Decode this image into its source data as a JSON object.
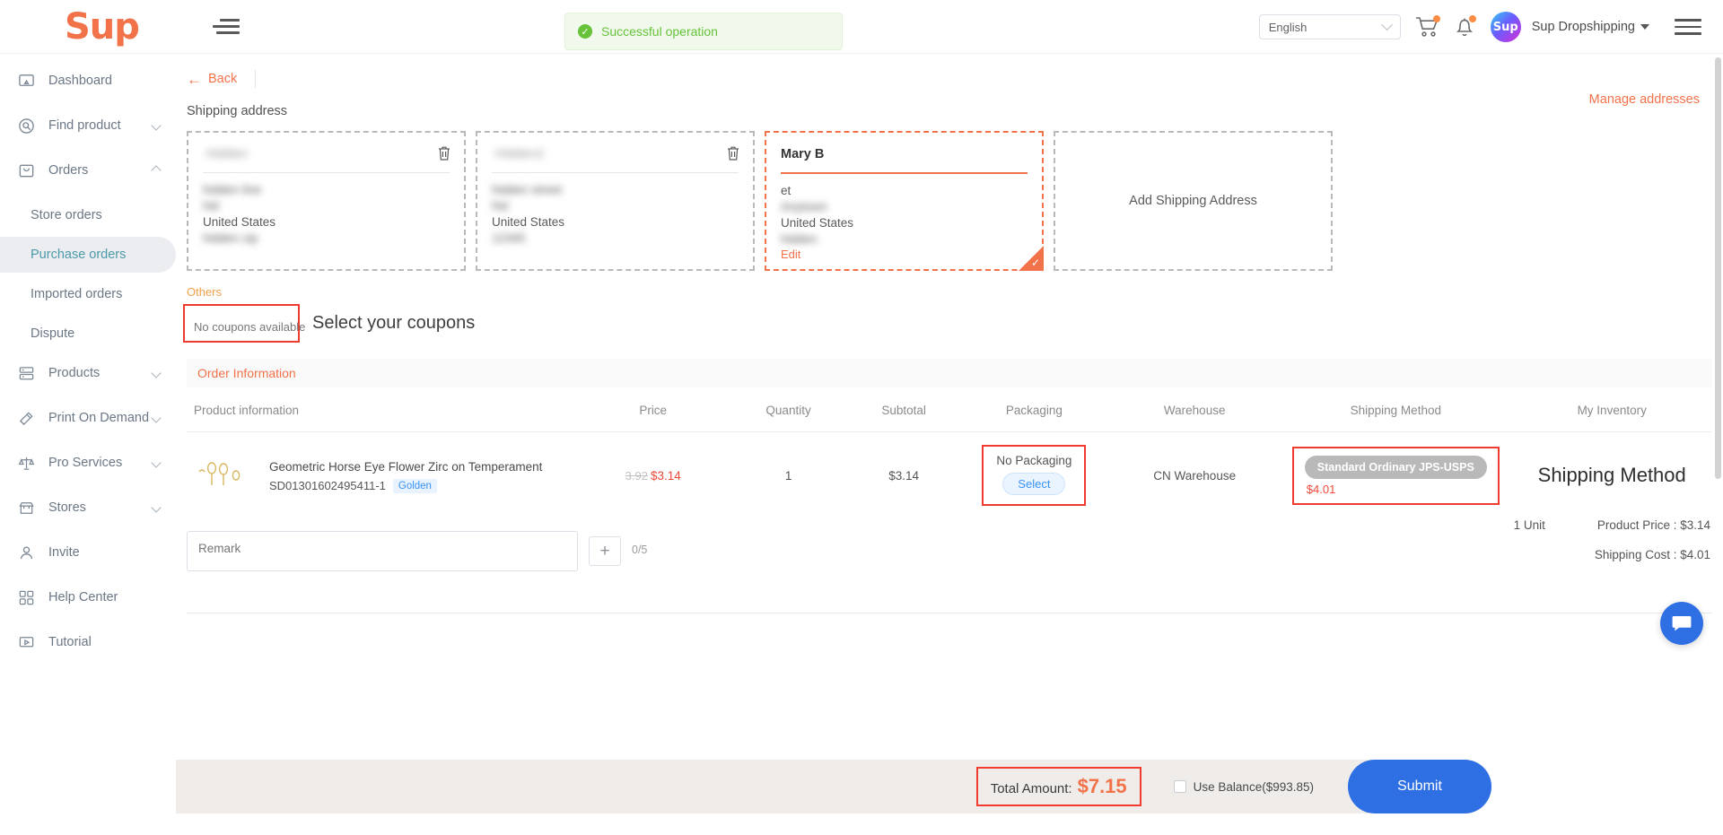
{
  "header": {
    "logo_text": "Sup",
    "collapse_icon": "collapse-sidebar-icon",
    "toast_message": "Successful operation",
    "toast_icon": "success-check-icon",
    "language": "English",
    "cart_icon": "shopping-cart-icon",
    "bell_icon": "notification-bell-icon",
    "avatar_text": "Sup",
    "user_name": "Sup Dropshipping",
    "menu_icon": "hamburger-menu-icon"
  },
  "sidebar": {
    "items": [
      {
        "label": "Dashboard",
        "icon": "dashboard-icon",
        "expandable": false
      },
      {
        "label": "Find product",
        "icon": "search-circle-icon",
        "expandable": true
      },
      {
        "label": "Orders",
        "icon": "orders-bag-icon",
        "expandable": true
      }
    ],
    "sub_items": [
      {
        "label": "Store orders",
        "active": false
      },
      {
        "label": "Purchase orders",
        "active": true
      },
      {
        "label": "Imported orders",
        "active": false
      },
      {
        "label": "Dispute",
        "active": false
      }
    ],
    "items_bottom": [
      {
        "label": "Products",
        "icon": "products-stack-icon",
        "expandable": true
      },
      {
        "label": "Print On Demand",
        "icon": "print-on-demand-icon",
        "expandable": true
      },
      {
        "label": "Pro Services",
        "icon": "scales-icon",
        "expandable": true
      },
      {
        "label": "Stores",
        "icon": "storefront-icon",
        "expandable": true
      },
      {
        "label": "Invite",
        "icon": "person-invite-icon",
        "expandable": false
      },
      {
        "label": "Help Center",
        "icon": "help-center-icon",
        "expandable": false
      },
      {
        "label": "Tutorial",
        "icon": "tutorial-icon",
        "expandable": false
      }
    ]
  },
  "main": {
    "back_label": "Back",
    "shipping_address_label": "Shipping address",
    "manage_addresses_label": "Manage addresses",
    "addresses": [
      {
        "name": "",
        "line1": "",
        "line2": "",
        "country": "United States",
        "zip": "",
        "selected": false,
        "blurred": true
      },
      {
        "name": "",
        "line1": "",
        "line2": "",
        "country": "United States",
        "zip": "",
        "selected": false,
        "blurred": true
      },
      {
        "name": "Mary B",
        "line1": "et",
        "line2": "",
        "country": "United States",
        "zip": "",
        "edit_label": "Edit",
        "selected": true,
        "blurred": false
      }
    ],
    "add_address_label": "Add Shipping Address",
    "others_label": "Others",
    "no_coupons_label": "No coupons available",
    "select_coupons_title": "Select your coupons",
    "order_information_label": "Order Information",
    "table_headers": [
      "Product information",
      "Price",
      "Quantity",
      "Subtotal",
      "Packaging",
      "Warehouse",
      "Shipping Method",
      "My Inventory"
    ],
    "product_row": {
      "title": "Geometric Horse Eye Flower Zirc on Temperament",
      "sku": "SD01301602495411-1",
      "variant_tag": "Golden",
      "price_original": "3.92",
      "price_current": "$3.14",
      "quantity": "1",
      "subtotal": "$3.14",
      "packaging_label": "No Packaging",
      "packaging_button": "Select",
      "warehouse": "CN Warehouse",
      "shipping_method": "Standard Ordinary JPS-USPS",
      "shipping_price": "$4.01",
      "inventory_annotation": "Shipping Method"
    },
    "remark_placeholder": "Remark",
    "remark_counter": "0/5",
    "add_image_icon": "plus-icon",
    "totals": {
      "unit_label": "1 Unit",
      "product_price": "Product Price : $3.14",
      "shipping_cost": "Shipping Cost : $4.01"
    }
  },
  "bottom_bar": {
    "total_label": "Total Amount:",
    "total_amount": "$7.15",
    "use_balance_label": "Use Balance($993.85)",
    "submit_label": "Submit"
  },
  "colors": {
    "brand_orange": "#f2724a",
    "accent_red": "#f13b2f",
    "submit_blue": "#2f6fe4",
    "active_teal": "#4d9aa8",
    "success_green": "#67c23a"
  }
}
